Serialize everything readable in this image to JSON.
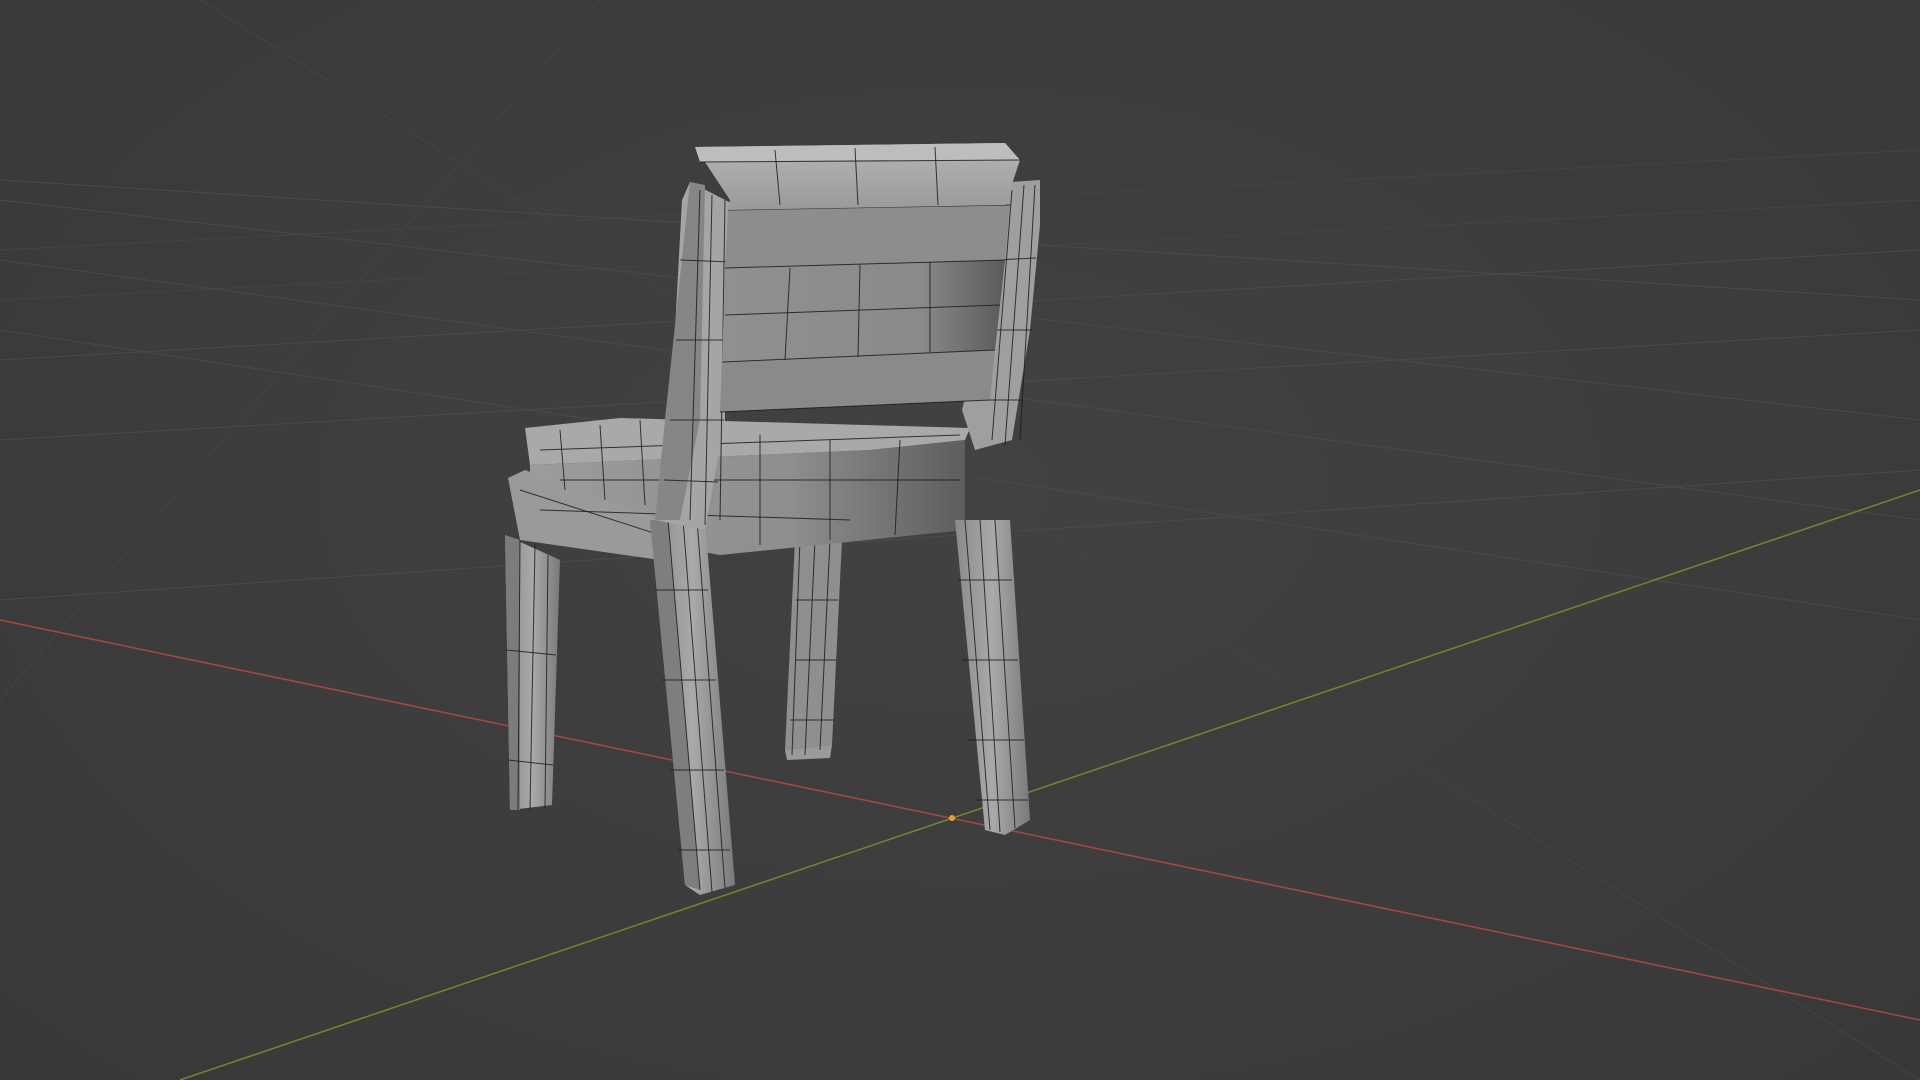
{
  "viewport": {
    "background": "#3d3d3d",
    "object": "chair-mesh",
    "shading": "solid-wireframe",
    "x_axis_color": "#b04444",
    "y_axis_color": "#6f8a2a",
    "origin_color": "#f0a020"
  }
}
